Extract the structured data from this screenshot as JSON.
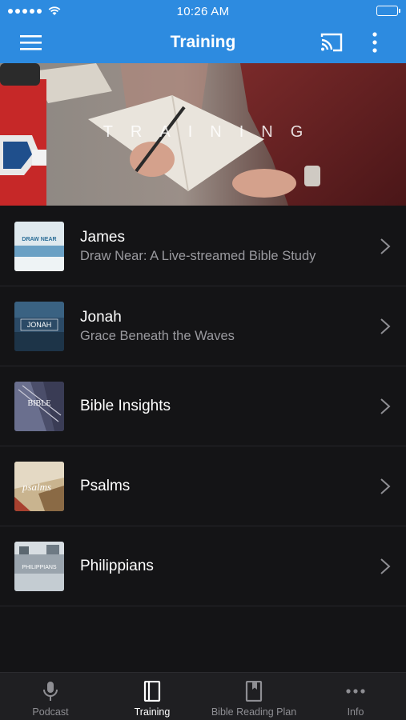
{
  "status_bar": {
    "time": "10:26 AM"
  },
  "app_bar": {
    "title": "Training"
  },
  "hero": {
    "title": "TRAINING"
  },
  "list": {
    "items": [
      {
        "title": "James",
        "subtitle": "Draw Near: A Live-streamed Bible Study",
        "thumb_text": "DRAW NEAR"
      },
      {
        "title": "Jonah",
        "subtitle": "Grace Beneath the Waves",
        "thumb_text": "JONAH"
      },
      {
        "title": "Bible Insights",
        "subtitle": "",
        "thumb_text": "BIBLE"
      },
      {
        "title": "Psalms",
        "subtitle": "",
        "thumb_text": "psalms"
      },
      {
        "title": "Philippians",
        "subtitle": "",
        "thumb_text": "PHILIPPIANS"
      }
    ]
  },
  "tab_bar": {
    "tabs": [
      {
        "label": "Podcast",
        "icon": "microphone-icon",
        "active": false
      },
      {
        "label": "Training",
        "icon": "book-icon",
        "active": true
      },
      {
        "label": "Bible Reading Plan",
        "icon": "bookmark-book-icon",
        "active": false
      },
      {
        "label": "Info",
        "icon": "more-dots-icon",
        "active": false
      }
    ]
  },
  "colors": {
    "accent": "#2d8be0",
    "background": "#141416",
    "tab_bar": "#1f1f22",
    "subtitle": "#9a9a9f"
  }
}
